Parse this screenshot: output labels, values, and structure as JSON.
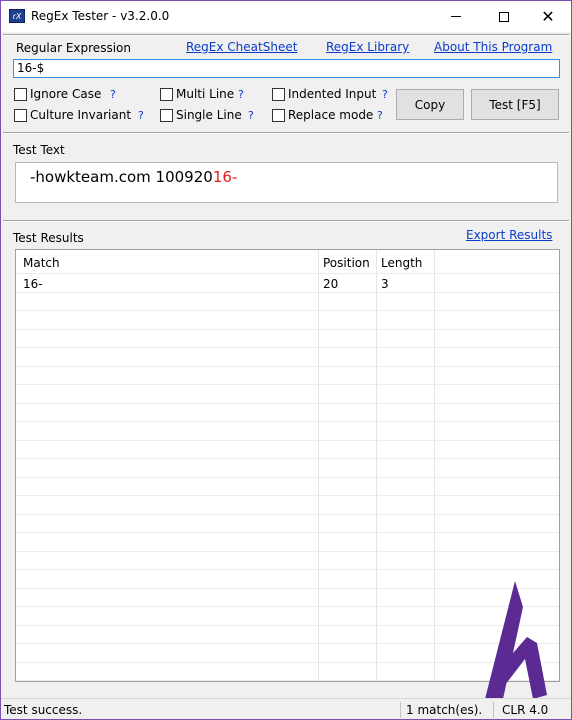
{
  "window": {
    "title": "RegEx Tester - v3.2.0.0",
    "icon_text": "rX",
    "accent": "#7a4fb5"
  },
  "regex_section": {
    "label": "Regular Expression",
    "links": {
      "cheatsheet": "RegEx CheatSheet",
      "library": "RegEx Library",
      "about": "About This Program"
    },
    "value": "16-$"
  },
  "options": {
    "ignore_case": {
      "label": "Ignore Case",
      "help": "?",
      "checked": false
    },
    "multi_line": {
      "label": "Multi Line",
      "help": "?",
      "checked": false
    },
    "indented_input": {
      "label": "Indented Input",
      "help": "?",
      "checked": false
    },
    "culture_invariant": {
      "label": "Culture Invariant",
      "help": "?",
      "checked": false
    },
    "single_line": {
      "label": "Single Line",
      "help": "?",
      "checked": false
    },
    "replace_mode": {
      "label": "Replace mode",
      "help": "?",
      "checked": false
    }
  },
  "buttons": {
    "copy": "Copy",
    "test": "Test [F5]"
  },
  "test_text_section": {
    "label": "Test Text",
    "text_before": "-howkteam.com 10092016-",
    "text_plain": "-howkteam.com 100920",
    "text_match": "16-",
    "match_color": "#e21b1b"
  },
  "results_section": {
    "label": "Test Results",
    "export_link": "Export Results",
    "columns": [
      "Match",
      "Position",
      "Length"
    ],
    "rows": [
      {
        "match": "16-",
        "position": "20",
        "length": "3"
      }
    ]
  },
  "statusbar": {
    "status": "Test success.",
    "match_count": "1 match(es).",
    "clr": "CLR 4.0"
  }
}
